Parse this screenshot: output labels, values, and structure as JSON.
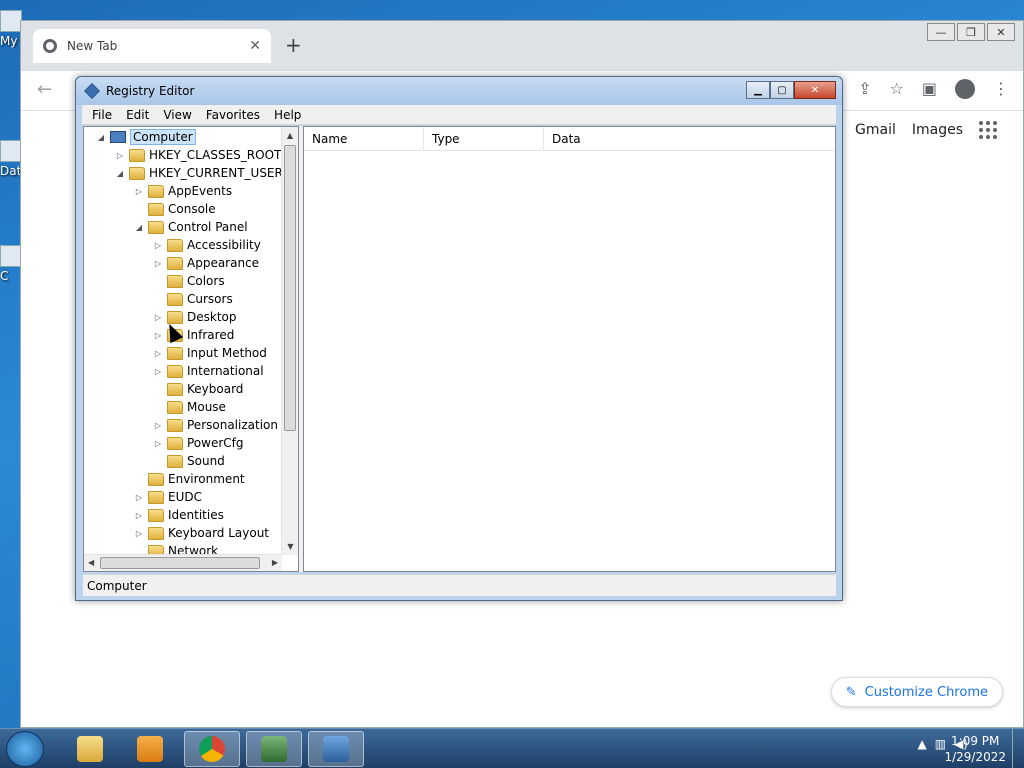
{
  "desktop": {
    "icons": [
      "My",
      "Dat",
      "C"
    ]
  },
  "chrome": {
    "tab_title": "New Tab",
    "tab_close": "✕",
    "new_tab": "+",
    "links": [
      "Gmail",
      "Images"
    ],
    "customize_label": "Customize Chrome"
  },
  "regedit": {
    "title": "Registry Editor",
    "menu": [
      "File",
      "Edit",
      "View",
      "Favorites",
      "Help"
    ],
    "tree": [
      {
        "label": "Computer",
        "depth": 0,
        "expander": "◢",
        "icon": "computer-icon",
        "selected": true
      },
      {
        "label": "HKEY_CLASSES_ROOT",
        "depth": 1,
        "expander": "▷",
        "icon": "folder-icon"
      },
      {
        "label": "HKEY_CURRENT_USER",
        "depth": 1,
        "expander": "◢",
        "icon": "folder-icon"
      },
      {
        "label": "AppEvents",
        "depth": 2,
        "expander": "▷",
        "icon": "folder-icon"
      },
      {
        "label": "Console",
        "depth": 2,
        "expander": "",
        "icon": "folder-icon"
      },
      {
        "label": "Control Panel",
        "depth": 2,
        "expander": "◢",
        "icon": "folder-icon"
      },
      {
        "label": "Accessibility",
        "depth": 3,
        "expander": "▷",
        "icon": "folder-icon"
      },
      {
        "label": "Appearance",
        "depth": 3,
        "expander": "▷",
        "icon": "folder-icon"
      },
      {
        "label": "Colors",
        "depth": 3,
        "expander": "",
        "icon": "folder-icon"
      },
      {
        "label": "Cursors",
        "depth": 3,
        "expander": "",
        "icon": "folder-icon"
      },
      {
        "label": "Desktop",
        "depth": 3,
        "expander": "▷",
        "icon": "folder-icon"
      },
      {
        "label": "Infrared",
        "depth": 3,
        "expander": "▷",
        "icon": "folder-icon"
      },
      {
        "label": "Input Method",
        "depth": 3,
        "expander": "▷",
        "icon": "folder-icon"
      },
      {
        "label": "International",
        "depth": 3,
        "expander": "▷",
        "icon": "folder-icon"
      },
      {
        "label": "Keyboard",
        "depth": 3,
        "expander": "",
        "icon": "folder-icon"
      },
      {
        "label": "Mouse",
        "depth": 3,
        "expander": "",
        "icon": "folder-icon"
      },
      {
        "label": "Personalization",
        "depth": 3,
        "expander": "▷",
        "icon": "folder-icon"
      },
      {
        "label": "PowerCfg",
        "depth": 3,
        "expander": "▷",
        "icon": "folder-icon"
      },
      {
        "label": "Sound",
        "depth": 3,
        "expander": "",
        "icon": "folder-icon"
      },
      {
        "label": "Environment",
        "depth": 2,
        "expander": "",
        "icon": "folder-icon"
      },
      {
        "label": "EUDC",
        "depth": 2,
        "expander": "▷",
        "icon": "folder-icon"
      },
      {
        "label": "Identities",
        "depth": 2,
        "expander": "▷",
        "icon": "folder-icon"
      },
      {
        "label": "Keyboard Layout",
        "depth": 2,
        "expander": "▷",
        "icon": "folder-icon"
      },
      {
        "label": "Network",
        "depth": 2,
        "expander": "",
        "icon": "folder-icon"
      }
    ],
    "columns": [
      "Name",
      "Type",
      "Data"
    ],
    "status": "Computer"
  },
  "taskbar": {
    "time": "1:09 PM",
    "date": "1/29/2022",
    "apps": [
      "explorer-icon",
      "media-player-icon",
      "chrome-icon",
      "task-manager-icon",
      "regedit-icon"
    ]
  }
}
